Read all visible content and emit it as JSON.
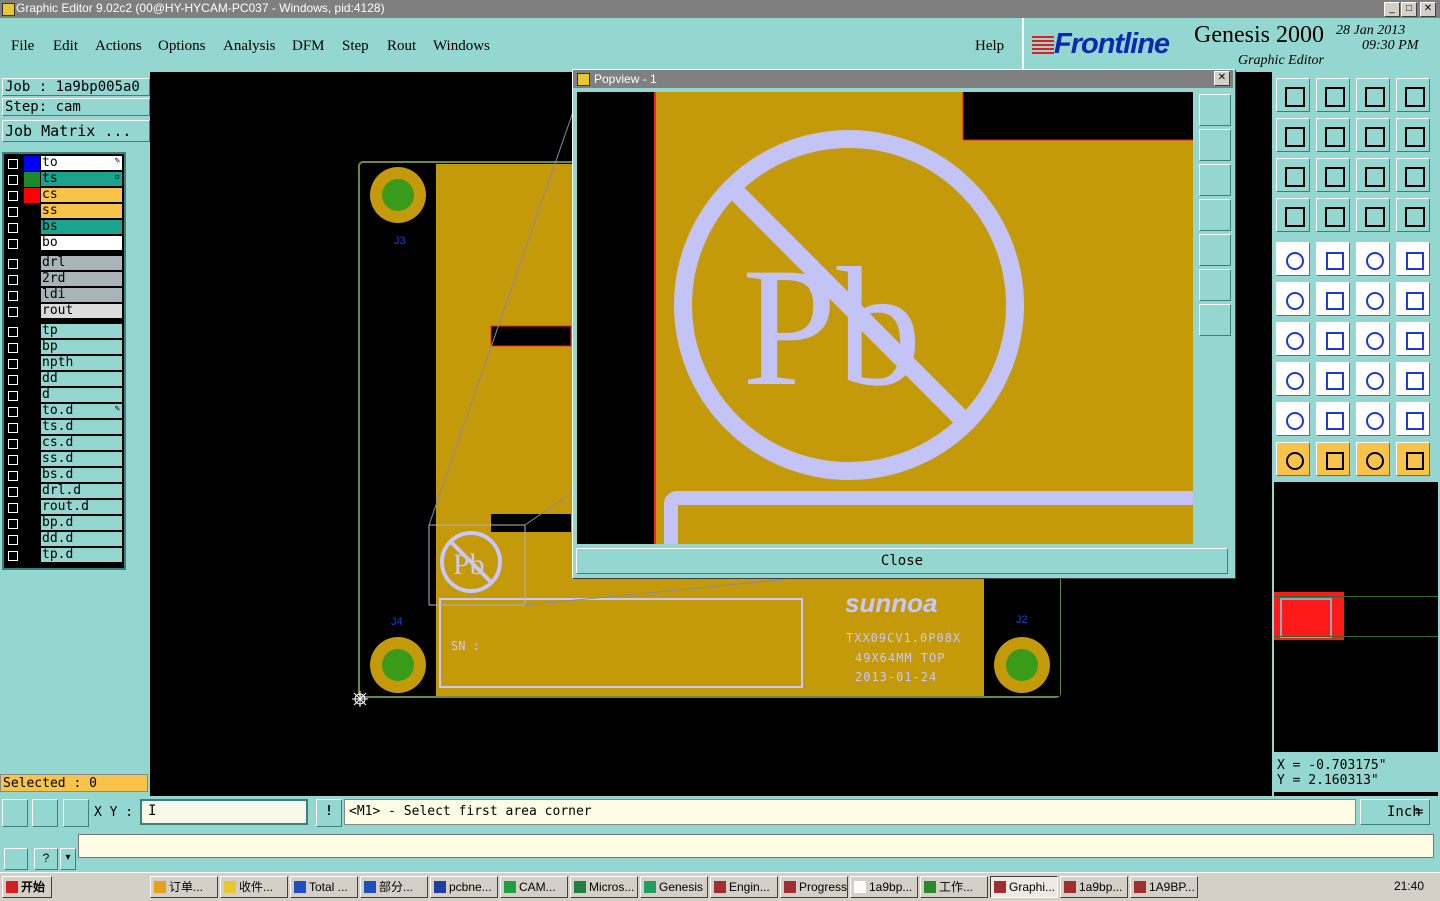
{
  "window": {
    "title": "Graphic Editor 9.02c2 (00@HY-HYCAM-PC037 - Windows, pid:4128)"
  },
  "menu": [
    {
      "label": "File"
    },
    {
      "label": "Edit"
    },
    {
      "label": "Actions"
    },
    {
      "label": "Options"
    },
    {
      "label": "Analysis"
    },
    {
      "label": "DFM"
    },
    {
      "label": "Step"
    },
    {
      "label": "Rout"
    },
    {
      "label": "Windows"
    },
    {
      "label": "Help"
    }
  ],
  "brand": {
    "logo": "Frontline",
    "product": "Genesis 2000",
    "subtitle": "Graphic Editor",
    "date": "28 Jan 2013",
    "time": "09:30 PM"
  },
  "job": {
    "job_label": "Job : 1a9bp005a0",
    "step_label": "Step: cam",
    "matrix_button": "Job Matrix ..."
  },
  "layers": [
    {
      "name": "to",
      "color": "#0000ff",
      "bg": "#ffffff",
      "mark": "✎"
    },
    {
      "name": "ts",
      "color": "#1a8a2a",
      "bg": "#1ba38e",
      "mark": "▫"
    },
    {
      "name": "cs",
      "color": "#ff0000",
      "bg": "#f7c34a",
      "mark": ""
    },
    {
      "name": "ss",
      "color": "#000000",
      "bg": "#f7c34a",
      "mark": ""
    },
    {
      "name": "bs",
      "color": "#000000",
      "bg": "#1ba38e",
      "mark": ""
    },
    {
      "name": "bo",
      "color": "#000000",
      "bg": "#ffffff",
      "mark": ""
    },
    {
      "name": "drl",
      "color": "#000000",
      "bg": "#a8b4b8",
      "mark": ""
    },
    {
      "name": "2rd",
      "color": "#000000",
      "bg": "#a8b4b8",
      "mark": ""
    },
    {
      "name": "ldi",
      "color": "#000000",
      "bg": "#a8b4b8",
      "mark": ""
    },
    {
      "name": "rout",
      "color": "#000000",
      "bg": "#dcdcdc",
      "mark": ""
    },
    {
      "name": "tp",
      "color": "#000000",
      "bg": "#93d7d0",
      "mark": ""
    },
    {
      "name": "bp",
      "color": "#000000",
      "bg": "#93d7d0",
      "mark": ""
    },
    {
      "name": "npth",
      "color": "#000000",
      "bg": "#93d7d0",
      "mark": ""
    },
    {
      "name": "dd",
      "color": "#000000",
      "bg": "#93d7d0",
      "mark": ""
    },
    {
      "name": "d",
      "color": "#000000",
      "bg": "#93d7d0",
      "mark": ""
    },
    {
      "name": "to.d",
      "color": "#000000",
      "bg": "#93d7d0",
      "mark": "✎"
    },
    {
      "name": "ts.d",
      "color": "#000000",
      "bg": "#93d7d0",
      "mark": ""
    },
    {
      "name": "cs.d",
      "color": "#000000",
      "bg": "#93d7d0",
      "mark": ""
    },
    {
      "name": "ss.d",
      "color": "#000000",
      "bg": "#93d7d0",
      "mark": ""
    },
    {
      "name": "bs.d",
      "color": "#000000",
      "bg": "#93d7d0",
      "mark": ""
    },
    {
      "name": "drl.d",
      "color": "#000000",
      "bg": "#93d7d0",
      "mark": ""
    },
    {
      "name": "rout.d",
      "color": "#000000",
      "bg": "#93d7d0",
      "mark": ""
    },
    {
      "name": "bp.d",
      "color": "#000000",
      "bg": "#93d7d0",
      "mark": ""
    },
    {
      "name": "dd.d",
      "color": "#000000",
      "bg": "#93d7d0",
      "mark": ""
    },
    {
      "name": "tp.d",
      "color": "#000000",
      "bg": "#93d7d0",
      "mark": ""
    }
  ],
  "selected": "Selected : 0",
  "board": {
    "labels": {
      "j3": "J3",
      "j4": "J4",
      "j2": "J2"
    },
    "sn": "SN :",
    "brand_mark": "sunnoa",
    "text_lines": [
      "TXX09CV1.0P08X",
      "49X64MM TOP",
      "2013-01-24"
    ],
    "pb": "Pb"
  },
  "popview": {
    "title": "Popview - 1",
    "close_label": "Close"
  },
  "coords": {
    "x": "X = -0.703175\"",
    "y": "Y = 2.160313\""
  },
  "cmd": {
    "xy_label": "X Y :",
    "xy_value": "",
    "prompt": "<M1> - Select first area corner",
    "unit": "Inch"
  },
  "taskbar": {
    "start": "开始",
    "tasks": [
      "订单...",
      "收件...",
      "Total ...",
      "部分...",
      "pcbne...",
      "CAM...",
      "Micros...",
      "Genesis",
      "Engin...",
      "Progress",
      "1a9bp...",
      "工作...",
      "Graphi...",
      "1a9bp...",
      "1A9BP..."
    ],
    "clock": "21:40"
  }
}
